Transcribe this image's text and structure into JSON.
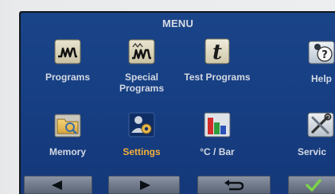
{
  "screen": {
    "title": "MENU"
  },
  "menu": {
    "items": [
      {
        "label": "Programs",
        "icon": "programs-waveform-icon"
      },
      {
        "label": "Special Programs",
        "icon": "special-programs-waveform-icon"
      },
      {
        "label": "Test Programs",
        "icon": "test-programs-t-icon"
      },
      {
        "label": "Help",
        "icon": "help-icon"
      },
      {
        "label": "Memory",
        "icon": "memory-folder-icon"
      },
      {
        "label": "Settings",
        "icon": "settings-user-gear-icon",
        "selected": true
      },
      {
        "label": "°C / Bar",
        "icon": "units-bar-chart-icon"
      },
      {
        "label": "Servic",
        "icon": "service-tools-icon"
      }
    ]
  },
  "toolbar": {
    "buttons": [
      {
        "name": "left",
        "icon": "arrow-left-icon"
      },
      {
        "name": "right",
        "icon": "arrow-right-icon"
      },
      {
        "name": "back",
        "icon": "return-icon"
      },
      {
        "name": "confirm",
        "icon": "check-icon"
      }
    ]
  },
  "colors": {
    "screen_background": "#173f83",
    "label_text": "#d4d9e2",
    "selected_label": "#f4b03a",
    "confirm_check": "#7cd34a"
  }
}
